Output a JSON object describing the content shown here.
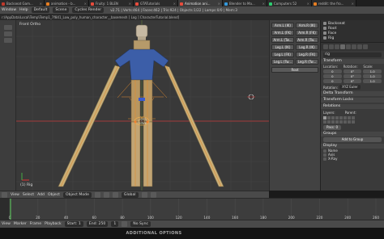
{
  "browser_tabs": [
    {
      "label": "Backseat Gam...",
      "color": "#c0392b"
    },
    {
      "label": "animation - b...",
      "color": "#e67e22"
    },
    {
      "label": "Fruity: 1 BLEN",
      "color": "#e74c3c"
    },
    {
      "label": "GTATutorials",
      "color": "#e74c3c"
    },
    {
      "label": "Animation ani...",
      "color": "#e74c3c",
      "active": true
    },
    {
      "label": "Blender to Ma...",
      "color": "#3498db"
    },
    {
      "label": "Computers 52",
      "color": "#2ecc71"
    },
    {
      "label": "reddit: the fro...",
      "color": "#e67e22"
    }
  ],
  "info": {
    "menus": [
      "Window",
      "Help"
    ],
    "layout": "Default",
    "scene": "Scene",
    "engine": "Cycles Render",
    "stats": "v2.71 | Verts:464 | Faces:462 | Tris:924 | Objects:1/22 | Lamps:0/0 | Mem:3"
  },
  "path": "r:\\AppData\\Local\\Temp\\Temp1_7f841_Low_poly_human_character__basemesh [ Log ] CharacterTutorial.blend]",
  "viewport": {
    "label": "Front Ortho",
    "selected": "(1) Rig"
  },
  "bone_buttons": [
    [
      "Arm.L (IK)",
      "Arm.R (IK)"
    ],
    [
      "Arm.L (FK)",
      "Arm.R (FK)"
    ],
    [
      "Arm.L (Tw...",
      "Arm.R (Tw..."
    ],
    [
      "Leg.L (IK)",
      "Leg.R (IK)"
    ],
    [
      "Leg.L (FK)",
      "Leg.R (FK)"
    ],
    [
      "Leg.L (Tw...",
      "Leg.R (Tw..."
    ]
  ],
  "root_button": "Root",
  "outliner": [
    "Backseat",
    "Root",
    "Face",
    "Rig"
  ],
  "props": {
    "name": "rig",
    "transform_header": "Transform",
    "columns": [
      "Location:",
      "Rotation:",
      "Scale:"
    ],
    "loc": [
      "0",
      "0",
      "0"
    ],
    "rot": [
      "0°",
      "0°",
      "0°"
    ],
    "scale": [
      "1.0",
      "1.0",
      "1.0"
    ],
    "rotation_mode_label": "Rotation:",
    "rotation_mode": "XYZ Euler",
    "sections": [
      "Delta Transform",
      "Transform Locks",
      "Relations"
    ],
    "layers_label": "Layers:",
    "parent_label": "Parent:",
    "pass_index": "Pass: 0",
    "groups_header": "Groups",
    "add_group": "Add to Group",
    "display_header": "Display",
    "name_check": "Name",
    "axis_check": "Axis",
    "xray_check": "X-Ray"
  },
  "vheader": {
    "view": "View",
    "select": "Select",
    "add": "Add",
    "object": "Object",
    "mode": "Object Mode",
    "pivot": "Global"
  },
  "timeline": {
    "ticks": [
      "0",
      "20",
      "40",
      "60",
      "80",
      "100",
      "120",
      "140",
      "160",
      "180",
      "200",
      "220",
      "240",
      "260"
    ],
    "view": "View",
    "marker": "Marker",
    "frame": "Frame",
    "playback": "Playback",
    "start": "Start:",
    "start_val": "1",
    "end": "End:",
    "end_val": "250",
    "current": "1",
    "sync": "No Sync"
  },
  "footer": "ADDITIONAL OPTIONS"
}
